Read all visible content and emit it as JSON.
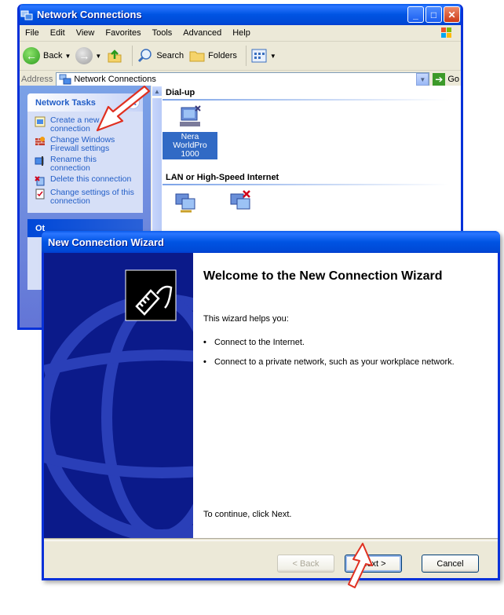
{
  "explorer": {
    "title": "Network Connections",
    "menu": [
      "File",
      "Edit",
      "View",
      "Favorites",
      "Tools",
      "Advanced",
      "Help"
    ],
    "toolbar": {
      "back": "Back",
      "search": "Search",
      "folders": "Folders"
    },
    "address": {
      "label": "Address",
      "value": "Network Connections",
      "go": "Go"
    },
    "network_tasks": {
      "header": "Network Tasks",
      "items": [
        "Create a new connection",
        "Change Windows Firewall settings",
        "Rename this connection",
        "Delete this connection",
        "Change settings of this connection"
      ]
    },
    "other_header": "Ot",
    "groups": {
      "dialup": "Dial-up",
      "lan": "LAN or High-Speed Internet"
    },
    "dialup_item": {
      "label_line1": "Nera WorldPro",
      "label_line2": "1000"
    }
  },
  "wizard": {
    "title": "New Connection Wizard",
    "heading": "Welcome to the New Connection Wizard",
    "intro": "This wizard helps you:",
    "bullets": [
      "Connect to the Internet.",
      "Connect to a private network, such as your workplace network."
    ],
    "footer_text": "To continue, click Next.",
    "buttons": {
      "back": "< Back",
      "next": "Next >",
      "cancel": "Cancel"
    }
  },
  "colors": {
    "xp_blue": "#0054e3",
    "task_link": "#215dc6",
    "annotation": "#e03020"
  }
}
